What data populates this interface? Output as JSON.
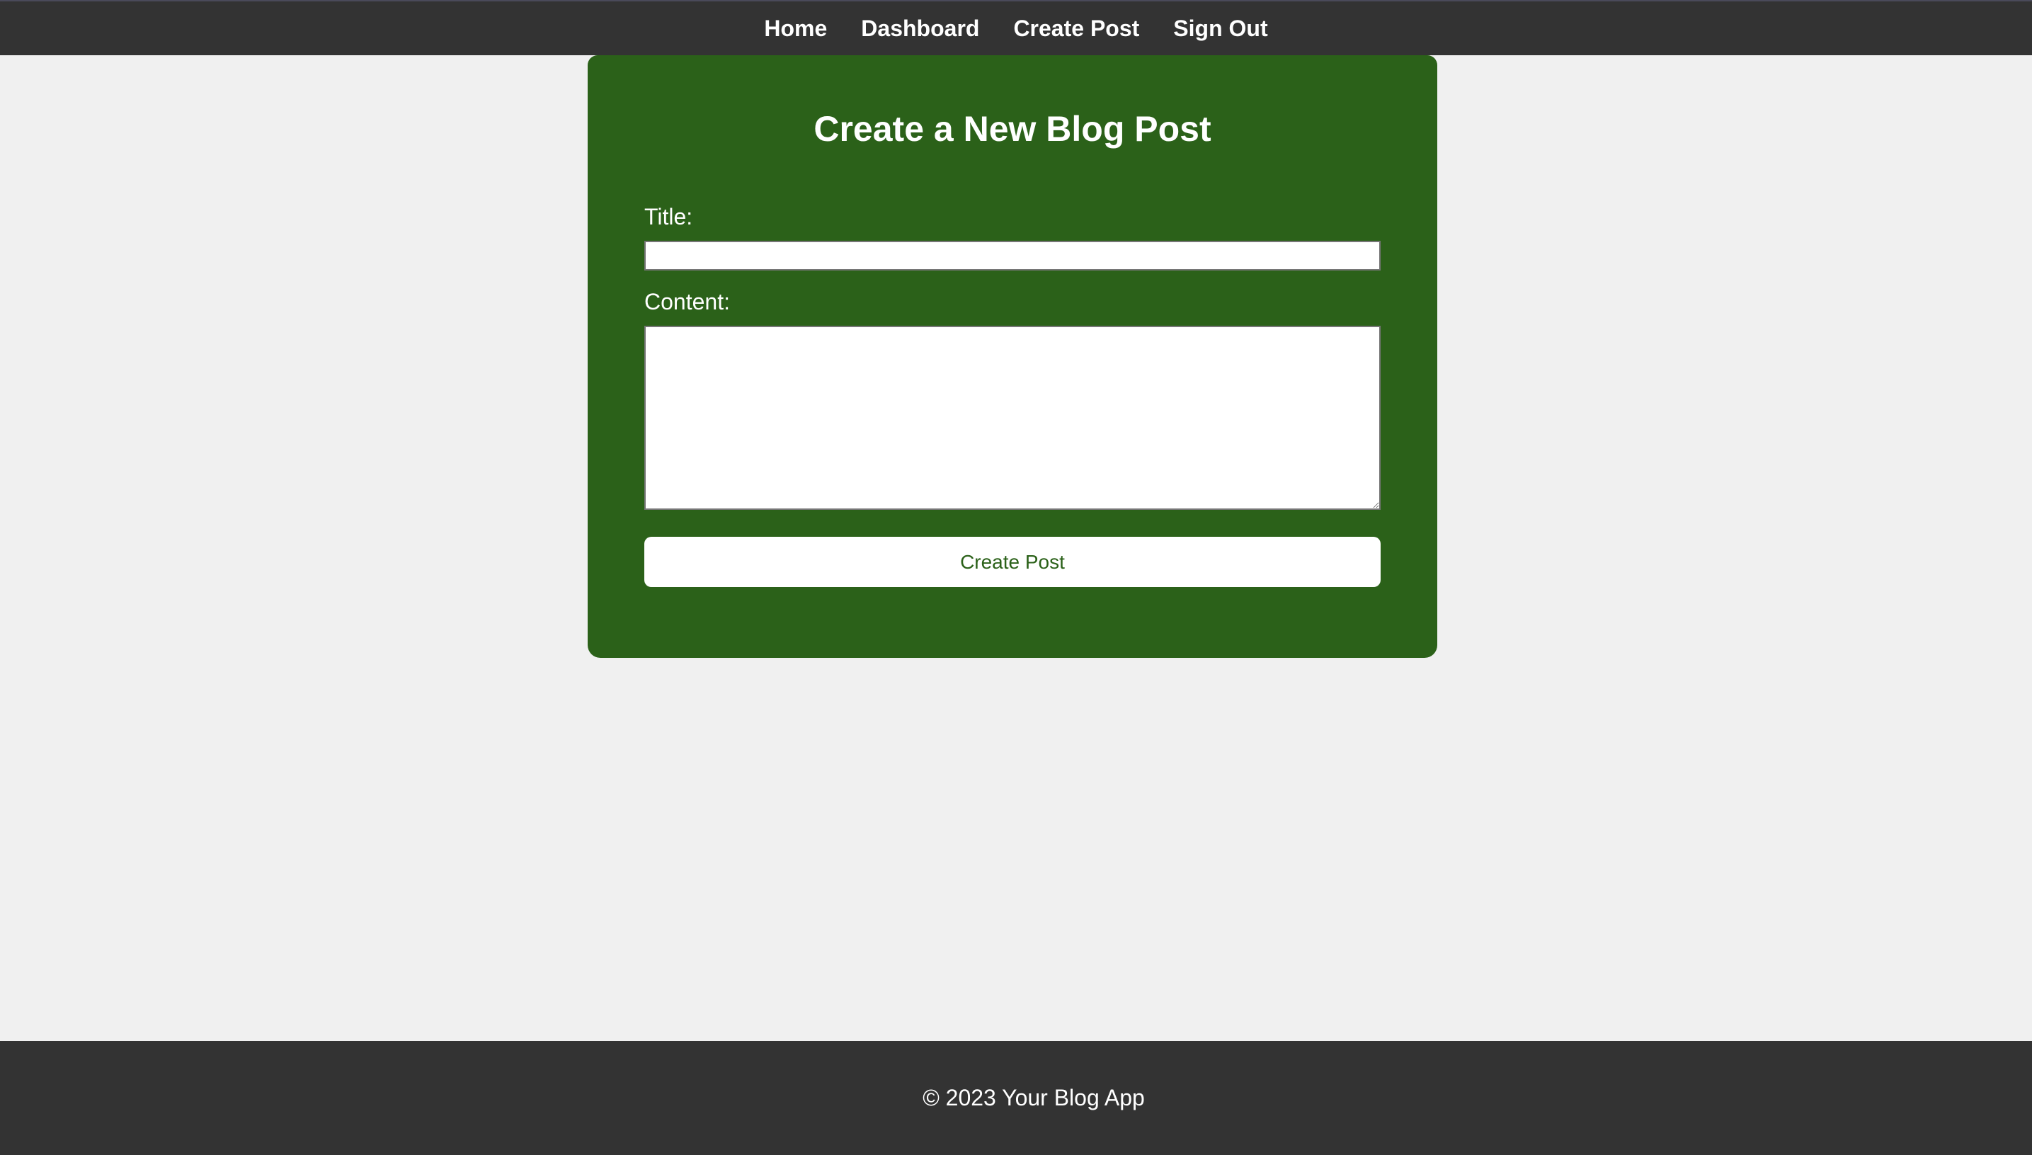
{
  "nav": {
    "items": [
      {
        "label": "Home"
      },
      {
        "label": "Dashboard"
      },
      {
        "label": "Create Post"
      },
      {
        "label": "Sign Out"
      }
    ]
  },
  "form": {
    "heading": "Create a New Blog Post",
    "title_label": "Title:",
    "title_value": "",
    "content_label": "Content:",
    "content_value": "",
    "submit_label": "Create Post"
  },
  "footer": {
    "text": "© 2023 Your Blog App"
  },
  "colors": {
    "navbar_bg": "#333333",
    "card_bg": "#2b6119",
    "page_bg": "#f0f0f0",
    "button_text": "#2b6119"
  }
}
